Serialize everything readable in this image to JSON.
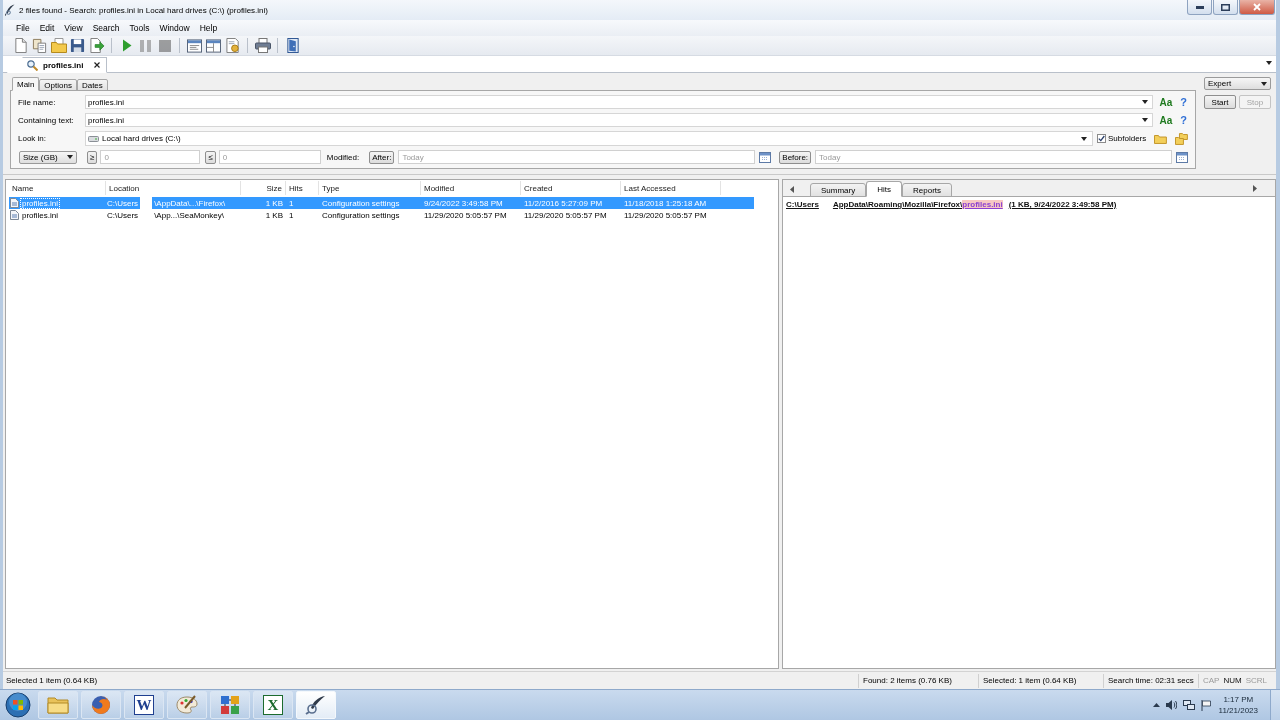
{
  "window": {
    "title": "2 files found - Search: profiles.ini in Local hard drives (C:\\) (profiles.ini)"
  },
  "menu": [
    "File",
    "Edit",
    "View",
    "Search",
    "Tools",
    "Window",
    "Help"
  ],
  "toolbar": [
    [
      {
        "kind": "new",
        "disabled": false
      },
      {
        "kind": "copy",
        "disabled": false
      },
      {
        "kind": "open",
        "disabled": false
      },
      {
        "kind": "save",
        "disabled": false
      },
      {
        "kind": "export",
        "disabled": false
      }
    ],
    [
      {
        "kind": "play",
        "disabled": false
      },
      {
        "kind": "pause",
        "disabled": true
      },
      {
        "kind": "stop",
        "disabled": true
      }
    ],
    [
      {
        "kind": "columns",
        "disabled": false
      },
      {
        "kind": "panes",
        "disabled": false
      },
      {
        "kind": "report",
        "disabled": false
      }
    ],
    [
      {
        "kind": "print",
        "disabled": false
      }
    ],
    [
      {
        "kind": "exit",
        "disabled": false
      }
    ]
  ],
  "document_tabs": [
    {
      "label": "profiles.ini",
      "selected": true
    }
  ],
  "search_form": {
    "tabs": [
      {
        "label": "Main",
        "selected": true
      },
      {
        "label": "Options",
        "selected": false
      },
      {
        "label": "Dates",
        "selected": false
      }
    ],
    "file_name": {
      "label": "File name:",
      "value": "profiles.ini",
      "case_button": "Aa",
      "help_button": "?"
    },
    "containing_text": {
      "label": "Containing text:",
      "value": "profiles.ini",
      "case_button": "Aa",
      "help_button": "?"
    },
    "look_in": {
      "label": "Look in:",
      "value": "Local hard drives (C:\\)",
      "subfolders": {
        "label": "Subfolders",
        "checked": true
      }
    },
    "size": {
      "unit": "Size (GB)",
      "min_button": "≥",
      "min_placeholder": "0",
      "max_button": "≤",
      "max_placeholder": "0"
    },
    "modified": {
      "label": "Modified:",
      "after_button": "After:",
      "after_placeholder": "Today",
      "before_button": "Before:",
      "before_placeholder": "Today"
    }
  },
  "mode": {
    "value": "Expert"
  },
  "actions": [
    {
      "label": "Start",
      "disabled": false
    },
    {
      "label": "Stop",
      "disabled": true
    }
  ],
  "results": {
    "columns": [
      "Name",
      "Location",
      "Size",
      "Hits",
      "Type",
      "Modified",
      "Created",
      "Last Accessed"
    ],
    "rows": [
      {
        "selected": true,
        "name": "profiles.ini",
        "location": [
          "C:\\Users",
          "\\AppData\\...\\Firefox\\"
        ],
        "size": "1 KB",
        "hits": "1",
        "type": "Configuration settings",
        "modified": "9/24/2022 3:49:58 PM",
        "created": "11/2/2016 5:27:09 PM",
        "accessed": "11/18/2018 1:25:18 AM"
      },
      {
        "selected": false,
        "name": "profiles.ini",
        "location": [
          "C:\\Users",
          "\\App...\\SeaMonkey\\"
        ],
        "size": "1 KB",
        "hits": "1",
        "type": "Configuration settings",
        "modified": "11/29/2020 5:05:57 PM",
        "created": "11/29/2020 5:05:57 PM",
        "accessed": "11/29/2020 5:05:57 PM"
      }
    ]
  },
  "preview": {
    "tabs": [
      {
        "label": "Summary",
        "selected": false
      },
      {
        "label": "Hits",
        "selected": true
      },
      {
        "label": "Reports",
        "selected": false
      }
    ],
    "hits": [
      {
        "path": [
          "C:\\Users",
          "AppData\\Roaming\\Mozilla\\Firefox\\"
        ],
        "match": "profiles.ini",
        "details": "(1 KB, 9/24/2022 3:49:58 PM)"
      }
    ]
  },
  "status_bar": {
    "message": "Selected 1 item (0.64 KB)",
    "found": "Found: 2 items (0.76 KB)",
    "selected": "Selected: 1 item (0.64 KB)",
    "time": "Search time: 02:31 secs",
    "keys": [
      {
        "label": "CAP",
        "on": false
      },
      {
        "label": "NUM",
        "on": true
      },
      {
        "label": "SCRL",
        "on": false
      }
    ]
  },
  "taskbar": {
    "apps": [
      {
        "kind": "folder",
        "selected": false
      },
      {
        "kind": "browser",
        "selected": false
      },
      {
        "kind": "letter",
        "glyph": "W",
        "selected": false
      },
      {
        "kind": "palette",
        "selected": false
      },
      {
        "kind": "squares",
        "selected": false
      },
      {
        "kind": "letter",
        "glyph": "X",
        "selected": false
      },
      {
        "kind": "quill",
        "selected": true
      }
    ],
    "time": "1:17 PM",
    "date": "11/21/2023"
  }
}
